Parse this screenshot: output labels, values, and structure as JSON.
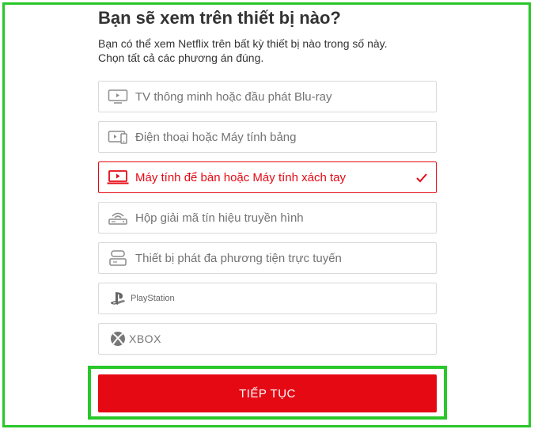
{
  "heading": "Bạn sẽ xem trên thiết bị nào?",
  "subtitle_lines": [
    "Bạn có thể xem Netflix trên bất kỳ thiết bị nào trong số này.",
    "Chọn tất cả các phương án đúng."
  ],
  "options": [
    {
      "label": "TV thông minh hoặc đầu phát Blu-ray",
      "icon": "tv-icon",
      "selected": false
    },
    {
      "label": "Điện thoại hoặc Máy tính bảng",
      "icon": "phone-tablet-icon",
      "selected": false
    },
    {
      "label": "Máy tính để bàn hoặc Máy tính xách tay",
      "icon": "laptop-icon",
      "selected": true
    },
    {
      "label": "Hộp giải mã tín hiệu truyền hình",
      "icon": "set-top-box-icon",
      "selected": false
    },
    {
      "label": "Thiết bị phát đa phương tiện trực tuyến",
      "icon": "streaming-device-icon",
      "selected": false
    },
    {
      "label": "PlayStation",
      "icon": "playstation-logo-icon",
      "selected": false
    },
    {
      "label": "XBOX",
      "icon": "xbox-logo-icon",
      "selected": false
    }
  ],
  "continue_label": "TIẾP TỤC",
  "colors": {
    "accent": "#e50914",
    "highlight": "#29c72a",
    "border": "#d9d9d9",
    "text": "#333333",
    "muted": "#737373"
  }
}
